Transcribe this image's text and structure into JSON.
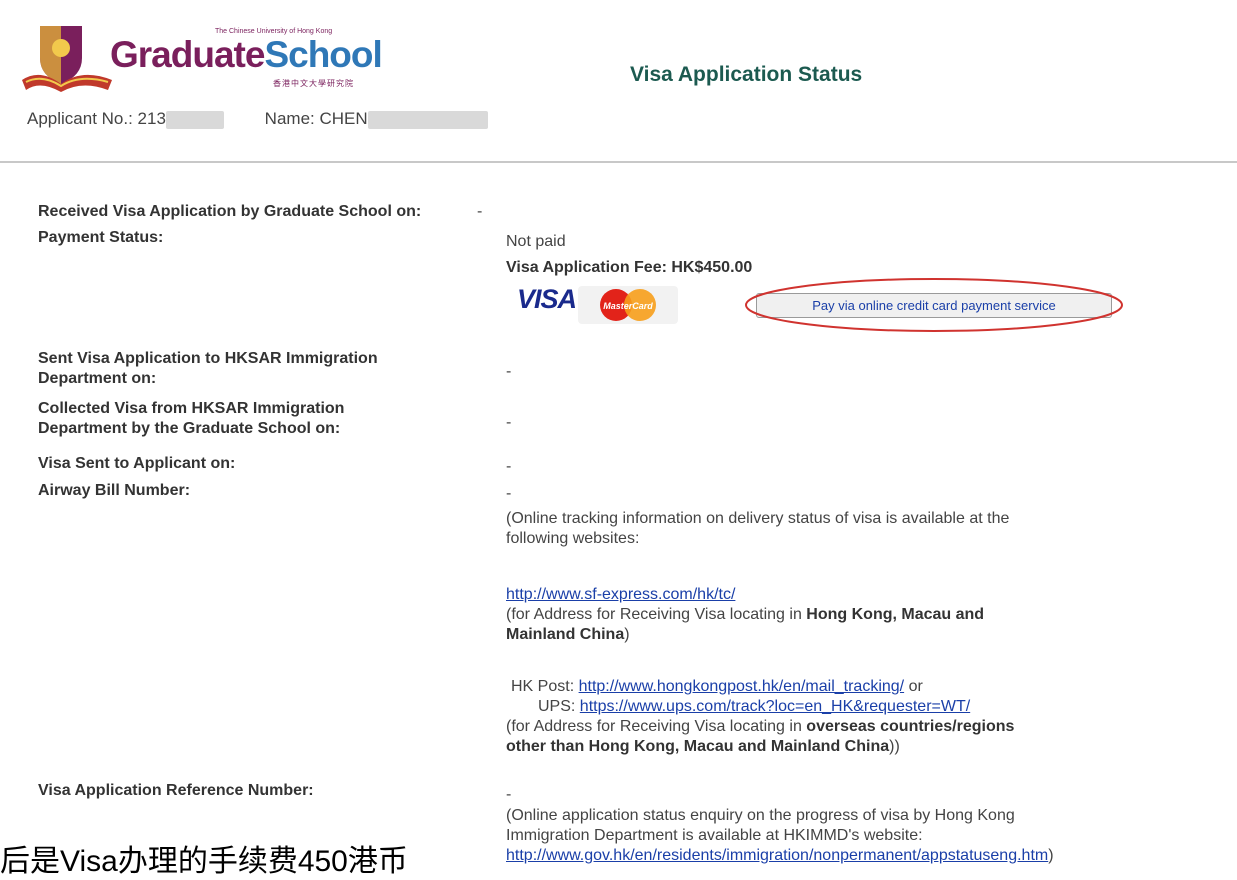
{
  "header": {
    "logo_small": "The Chinese University of Hong Kong",
    "logo_graduate": "Graduate",
    "logo_school": "School",
    "logo_chinese": "香港中文大學研究院",
    "title": "Visa Application Status"
  },
  "applicant": {
    "no_label": "Applicant No.: 21",
    "no_value_partial": "3",
    "name_label": "Name: CHE",
    "name_value_partial": "N"
  },
  "rows": {
    "received_label": "Received Visa Application by Graduate School on:",
    "received_value": "-",
    "payment_label": "Payment Status:",
    "payment_value": "Not paid",
    "fee_text": "Visa Application Fee: HK$450.00",
    "visa_logo": "VISA",
    "mastercard_logo": "MasterCard",
    "pay_button": "Pay via online credit card payment service",
    "sent_label_1": "Sent Visa Application to HKSAR Immigration",
    "sent_label_2": "Department on:",
    "sent_value": "-",
    "collected_label_1": "Collected Visa from HKSAR Immigration",
    "collected_label_2": "Department by the Graduate School on:",
    "collected_value": "-",
    "visa_sent_label": "Visa Sent to Applicant on:",
    "visa_sent_value": "-",
    "airway_label": "Airway Bill Number:",
    "airway_value": "-",
    "tracking_info_1": "(Online tracking information on delivery status of visa is available at the",
    "tracking_info_2": "following websites:",
    "sf_link": "http://www.sf-express.com/hk/tc/",
    "sf_note_1": "(for Address for Receiving Visa locating in ",
    "sf_note_bold_1": "Hong Kong, Macau and",
    "sf_note_bold_2": "Mainland China",
    "sf_note_end": ")",
    "hkpost_label": "HK Post:",
    "hkpost_link": "http://www.hongkongpost.hk/en/mail_tracking/",
    "hkpost_or": "or",
    "ups_label": "UPS:",
    "ups_link": "https://www.ups.com/track?loc=en_HK&requester=WT/",
    "overseas_note_1": "(for Address for Receiving Visa locating in ",
    "overseas_note_bold_1": "overseas countries/regions",
    "overseas_note_bold_2": "other than Hong Kong, Macau and Mainland China",
    "overseas_note_end": "))",
    "ref_label": "Visa Application Reference Number:",
    "ref_value": "-",
    "enquiry_1": "(Online application status enquiry on the progress of visa by Hong Kong",
    "enquiry_2": "Immigration Department is available at HKIMMD's website:",
    "immd_link": "http://www.gov.hk/en/residents/immigration/nonpermanent/appstatuseng.htm",
    "immd_end": ")"
  },
  "caption": "后是Visa办理的手续费450港币",
  "colors": {
    "title": "#1c5a50",
    "link": "#1a3fa8",
    "logo_purple": "#7a1f5c",
    "logo_blue": "#2f78b7",
    "highlight_red": "#d0332f"
  }
}
